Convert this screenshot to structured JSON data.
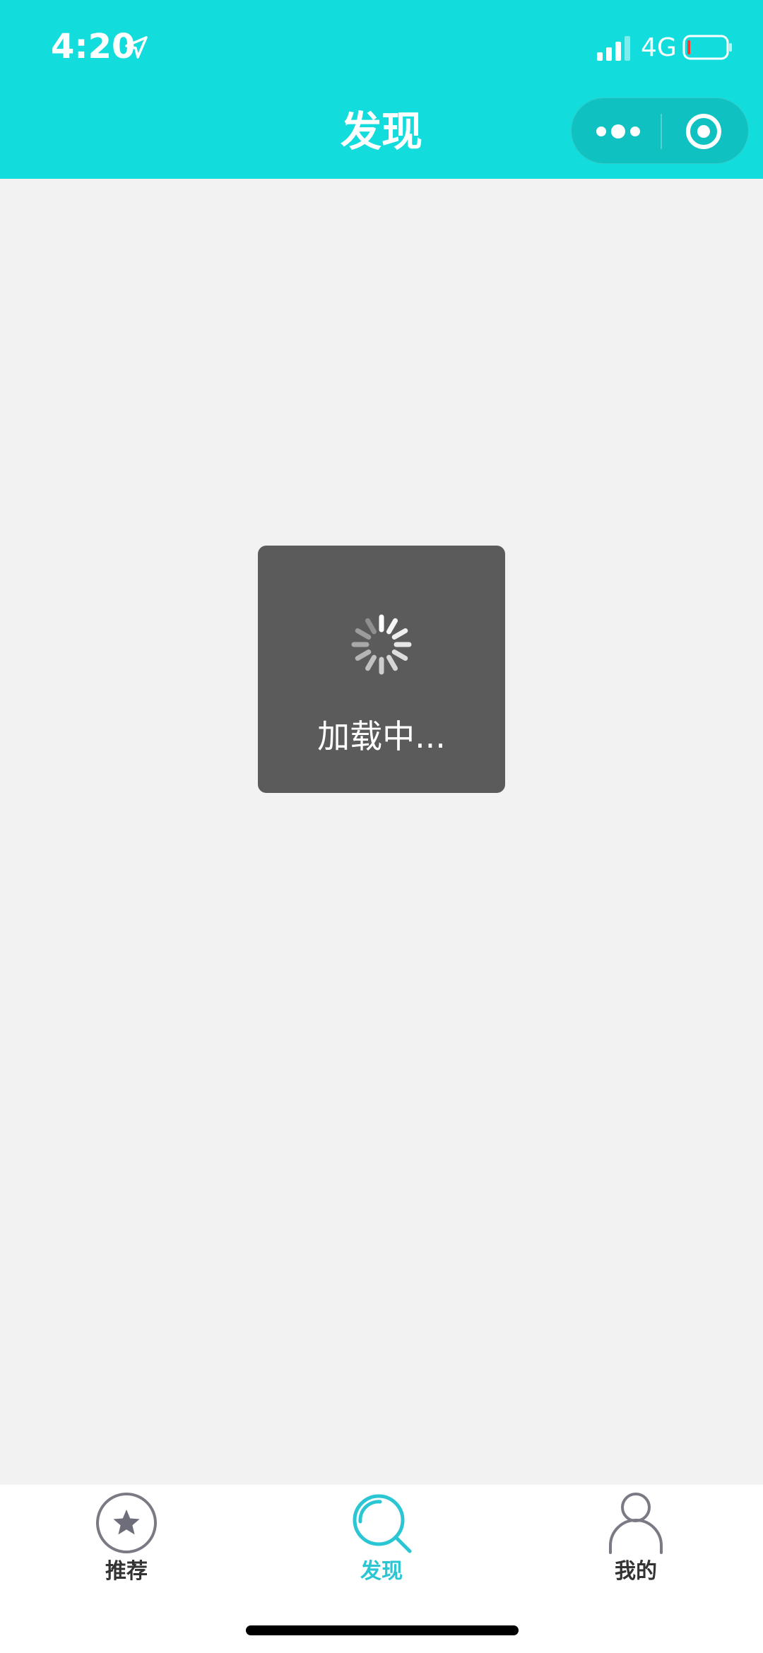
{
  "status_bar": {
    "time": "4:20",
    "network": "4G",
    "location_icon": "location-arrow-icon",
    "signal_icon": "signal-bars-icon",
    "battery_icon": "battery-low-icon"
  },
  "nav_bar": {
    "title": "发现",
    "more_icon": "more-dots-icon",
    "close_icon": "close-miniprogram-icon"
  },
  "loading_toast": {
    "text": "加载中...",
    "icon": "loading-spinner-icon"
  },
  "tabbar": {
    "tabs": [
      {
        "label": "推荐",
        "icon": "star-icon",
        "active": false
      },
      {
        "label": "发现",
        "icon": "discover-search-icon",
        "active": true
      },
      {
        "label": "我的",
        "icon": "user-icon",
        "active": false
      }
    ]
  },
  "colors": {
    "header": "#12dcdc",
    "accent": "#2bc6d3",
    "background": "#f2f2f2",
    "toast": "#5b5b5b",
    "battery_low": "#ff3b30"
  }
}
